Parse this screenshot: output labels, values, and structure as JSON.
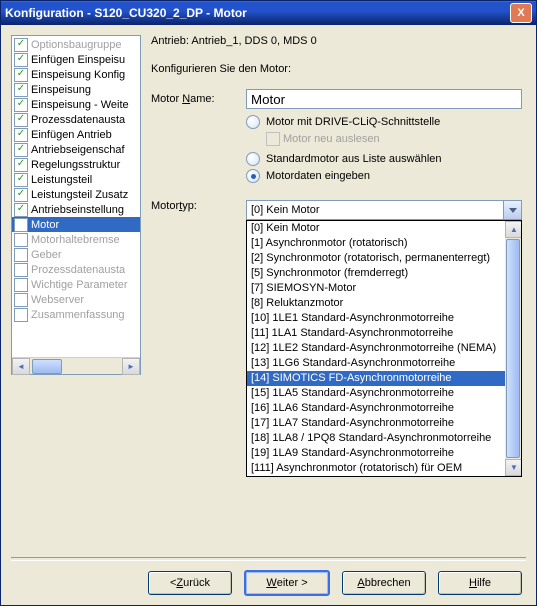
{
  "window": {
    "title": "Konfiguration - S120_CU320_2_DP - Motor",
    "close": "X"
  },
  "header": {
    "drive_line": "Antrieb: Antrieb_1, DDS 0, MDS 0",
    "configure_line": "Konfigurieren Sie den Motor:"
  },
  "tree": {
    "items": [
      {
        "label": "Optionsbaugruppe",
        "checked": true,
        "muted": true
      },
      {
        "label": "Einfügen Einspeisu",
        "checked": true,
        "muted": false
      },
      {
        "label": "Einspeisung Konfig",
        "checked": true,
        "muted": false
      },
      {
        "label": "Einspeisung",
        "checked": true,
        "muted": false
      },
      {
        "label": "Einspeisung - Weite",
        "checked": true,
        "muted": false
      },
      {
        "label": "Prozessdatenausta",
        "checked": true,
        "muted": false
      },
      {
        "label": "Einfügen Antrieb",
        "checked": true,
        "muted": false
      },
      {
        "label": "Antriebseigenschaf",
        "checked": true,
        "muted": false
      },
      {
        "label": "Regelungsstruktur",
        "checked": true,
        "muted": false
      },
      {
        "label": "Leistungsteil",
        "checked": true,
        "muted": false
      },
      {
        "label": "Leistungsteil Zusatz",
        "checked": true,
        "muted": false
      },
      {
        "label": "Antriebseinstellung",
        "checked": true,
        "muted": false
      },
      {
        "label": "Motor",
        "checked": null,
        "muted": false,
        "selected": true
      },
      {
        "label": "Motorhaltebremse",
        "checked": null,
        "muted": true
      },
      {
        "label": "Geber",
        "checked": null,
        "muted": true
      },
      {
        "label": "Prozessdatenausta",
        "checked": null,
        "muted": true
      },
      {
        "label": "Wichtige Parameter",
        "checked": null,
        "muted": true
      },
      {
        "label": "Webserver",
        "checked": null,
        "muted": true
      },
      {
        "label": "Zusammenfassung",
        "checked": null,
        "muted": true
      }
    ]
  },
  "form": {
    "motor_name_label_pre": "Motor ",
    "motor_name_label_u": "N",
    "motor_name_label_post": "ame:",
    "motor_name_value": "Motor",
    "opt_drivecliq_pre": "Motor mit DRIVE-CLi",
    "opt_drivecliq_u": "Q",
    "opt_drivecliq_post": "-Schnittstelle",
    "sub_neu_auslesen": "Motor neu auslesen",
    "opt_standard_u": "S",
    "opt_standard_post": "tandardmotor aus Liste auswählen",
    "opt_motordaten_pre": "",
    "opt_motordaten_u": "M",
    "opt_motordaten_post": "otordaten eingeben",
    "motortyp_label": "Motortyp:",
    "motortyp_label_u": "t",
    "motortyp_value": "[0] Kein Motor",
    "dropdown": [
      "[0] Kein Motor",
      "[1] Asynchronmotor (rotatorisch)",
      "[2] Synchronmotor (rotatorisch, permanenterregt)",
      "[5] Synchronmotor (fremderregt)",
      "[7] SIEMOSYN-Motor",
      "[8] Reluktanzmotor",
      "[10] 1LE1 Standard-Asynchronmotorreihe",
      "[11] 1LA1 Standard-Asynchronmotorreihe",
      "[12] 1LE2 Standard-Asynchronmotorreihe (NEMA)",
      "[13] 1LG6 Standard-Asynchronmotorreihe",
      "[14] SIMOTICS FD-Asynchronmotorreihe",
      "[15] 1LA5 Standard-Asynchronmotorreihe",
      "[16] 1LA6 Standard-Asynchronmotorreihe",
      "[17] 1LA7 Standard-Asynchronmotorreihe",
      "[18] 1LA8 / 1PQ8 Standard-Asynchronmotorreihe",
      "[19] 1LA9 Standard-Asynchronmotorreihe",
      "[111] Asynchronmotor (rotatorisch) für OEM"
    ],
    "dropdown_selected_index": 10
  },
  "buttons": {
    "back_pre": "< ",
    "back_u": "Z",
    "back_post": "urück",
    "next_u": "W",
    "next_post": "eiter >",
    "cancel_u": "A",
    "cancel_post": "bbrechen",
    "help_u": "H",
    "help_post": "ilfe"
  }
}
